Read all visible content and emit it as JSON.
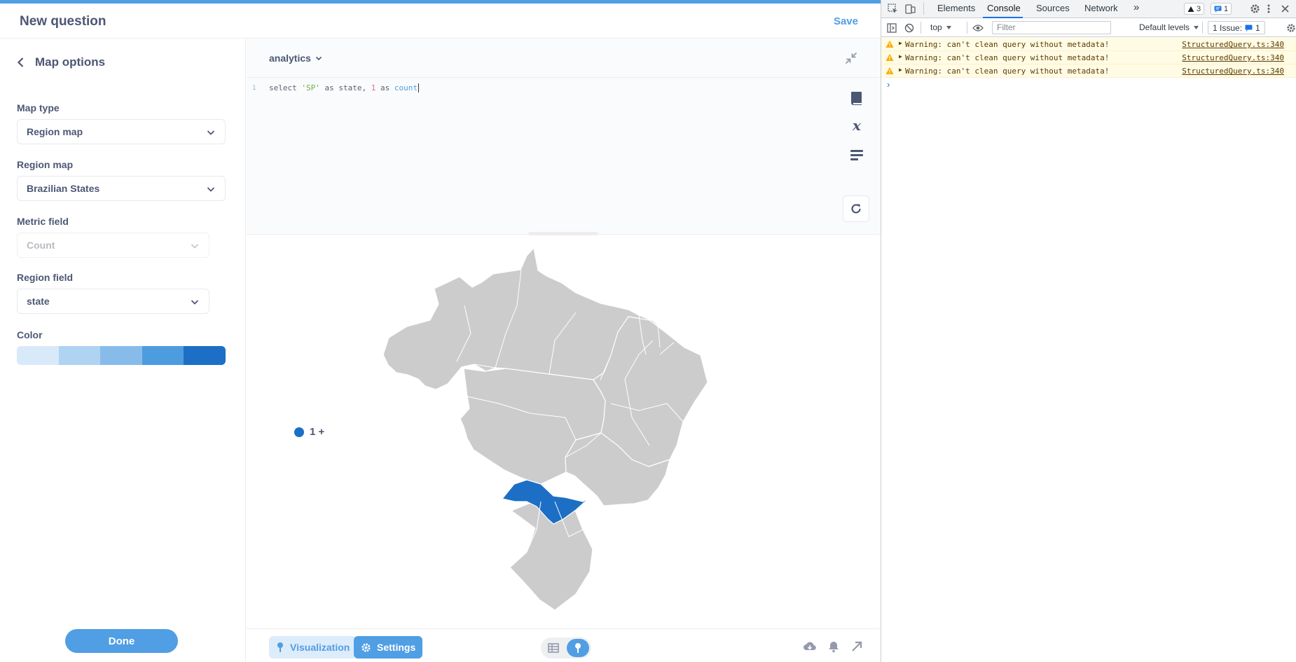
{
  "header": {
    "title": "New question",
    "save_label": "Save"
  },
  "sidebar": {
    "back_label": "Map options",
    "map_type": {
      "label": "Map type",
      "value": "Region map"
    },
    "region_map": {
      "label": "Region map",
      "value": "Brazilian States"
    },
    "metric_field": {
      "label": "Metric field",
      "value": "Count"
    },
    "region_field": {
      "label": "Region field",
      "value": "state"
    },
    "color": {
      "label": "Color",
      "swatches": [
        "#d8e9f9",
        "#b0d3f2",
        "#87bcea",
        "#4d9ce0",
        "#1c6fc4"
      ]
    },
    "done_label": "Done"
  },
  "editor": {
    "database": "analytics",
    "line_number": "1",
    "code": {
      "t1": "select ",
      "t2": "'SP'",
      "t3": " as state, ",
      "t4": "1",
      "t5": " as ",
      "t6": "count"
    }
  },
  "visualization": {
    "legend_label": "1 +",
    "legend_color": "#1c6fc4",
    "highlighted_region": "SP",
    "highlight_color": "#1c6fc4",
    "base_color": "#cccccc"
  },
  "footer": {
    "visualization_label": "Visualization",
    "settings_label": "Settings"
  },
  "devtools": {
    "tabs": [
      "Elements",
      "Console",
      "Sources",
      "Network"
    ],
    "active_tab": "Console",
    "more": "»",
    "warn_count": "3",
    "info_count": "1",
    "context": "top",
    "filter_placeholder": "Filter",
    "levels": "Default levels",
    "issues_label": "1 Issue:",
    "issues_count": "1",
    "messages": [
      {
        "text": "Warning: can't clean query without metadata!",
        "source": "StructuredQuery.ts:340"
      },
      {
        "text": "Warning: can't clean query without metadata!",
        "source": "StructuredQuery.ts:340"
      },
      {
        "text": "Warning: can't clean query without metadata!",
        "source": "StructuredQuery.ts:340"
      }
    ]
  }
}
